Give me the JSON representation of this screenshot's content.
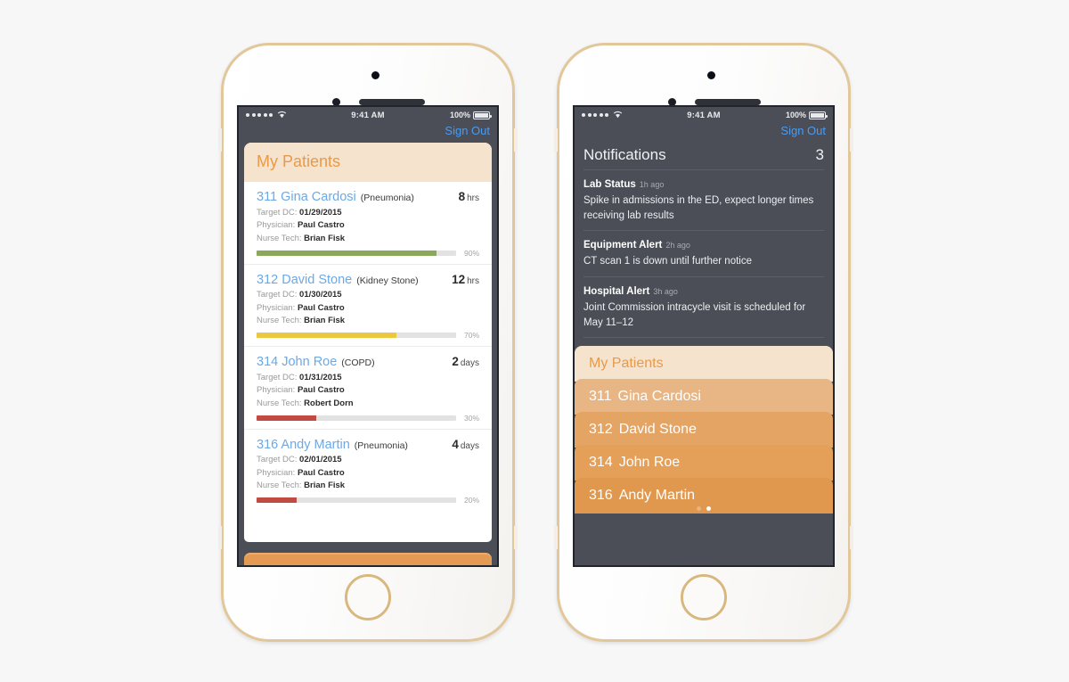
{
  "status_bar": {
    "signal_dots": 5,
    "wifi_icon": "wifi-icon",
    "time": "9:41 AM",
    "battery_percent": "100%",
    "battery_icon": "battery-full-icon"
  },
  "sign_out_label": "Sign Out",
  "colors": {
    "accent_orange": "#e79a4a",
    "banner_cream": "#f6e3cd",
    "link_blue": "#6aa9e8",
    "ios_blue": "#4a9bf0",
    "status_dark": "#4b4e57",
    "bar_green": "#8aa95a",
    "bar_yellow": "#ecc83f",
    "bar_red": "#bf4b42"
  },
  "phone1": {
    "header": "My Patients",
    "patients": [
      {
        "id": "311",
        "name": "Gina Cardosi",
        "diagnosis": "(Pneumonia)",
        "time_value": "8",
        "time_unit": "hrs",
        "target_dc_label": "Target DC:",
        "target_dc": "01/29/2015",
        "physician_label": "Physician:",
        "physician": "Paul Castro",
        "nurse_label": "Nurse Tech:",
        "nurse": "Brian Fisk",
        "progress": 90,
        "progress_label": "90%",
        "bar_color": "#8aa95a"
      },
      {
        "id": "312",
        "name": "David Stone",
        "diagnosis": "(Kidney Stone)",
        "time_value": "12",
        "time_unit": "hrs",
        "target_dc_label": "Target DC:",
        "target_dc": "01/30/2015",
        "physician_label": "Physician:",
        "physician": "Paul Castro",
        "nurse_label": "Nurse Tech:",
        "nurse": "Brian Fisk",
        "progress": 70,
        "progress_label": "70%",
        "bar_color": "#ecc83f"
      },
      {
        "id": "314",
        "name": "John Roe",
        "diagnosis": "(COPD)",
        "time_value": "2",
        "time_unit": "days",
        "target_dc_label": "Target DC:",
        "target_dc": "01/31/2015",
        "physician_label": "Physician:",
        "physician": "Paul Castro",
        "nurse_label": "Nurse Tech:",
        "nurse": "Robert Dorn",
        "progress": 30,
        "progress_label": "30%",
        "bar_color": "#bf4b42"
      },
      {
        "id": "316",
        "name": "Andy Martin",
        "diagnosis": "(Pneumonia)",
        "time_value": "4",
        "time_unit": "days",
        "target_dc_label": "Target DC:",
        "target_dc": "02/01/2015",
        "physician_label": "Physician:",
        "physician": "Paul Castro",
        "nurse_label": "Nurse Tech:",
        "nurse": "Brian Fisk",
        "progress": 20,
        "progress_label": "20%",
        "bar_color": "#bf4b42"
      }
    ],
    "page_dots": {
      "count": 2,
      "active_index": 1
    }
  },
  "phone2": {
    "notifications_title": "Notifications",
    "notifications_count": "3",
    "notifications": [
      {
        "title": "Lab Status",
        "ago": "1h ago",
        "text": "Spike in admissions in the ED, expect longer times receiving lab results"
      },
      {
        "title": "Equipment Alert",
        "ago": "2h ago",
        "text": "CT scan 1 is down until further notice"
      },
      {
        "title": "Hospital Alert",
        "ago": "3h ago",
        "text": "Joint Commission intracycle visit is scheduled for May 11–12"
      }
    ],
    "stack_header": "My Patients",
    "stack_rows": [
      {
        "id": "311",
        "name": "Gina Cardosi",
        "color": "#e8b684"
      },
      {
        "id": "312",
        "name": "David Stone",
        "color": "#e4a463"
      },
      {
        "id": "314",
        "name": "John Roe",
        "color": "#e49f58"
      },
      {
        "id": "316",
        "name": "Andy Martin",
        "color": "#e0974e"
      }
    ],
    "page_dots": {
      "count": 2,
      "active_index": 1
    }
  }
}
